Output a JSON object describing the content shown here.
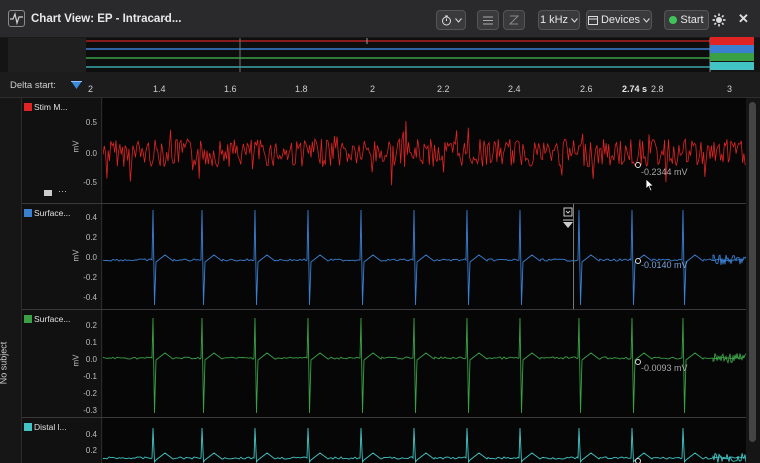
{
  "titlebar": {
    "title": "Chart View: EP - Intracard...",
    "more": "···",
    "rate": "1 kHz",
    "devices": "Devices",
    "start": "Start",
    "close": "✕"
  },
  "overview": {
    "colors": [
      "#e02424",
      "#3a7fd0",
      "#3aa046",
      "#43c4c4"
    ]
  },
  "delta": {
    "label": "Delta start:",
    "ticks": [
      "2",
      "1.4",
      "1.6",
      "1.8",
      "2",
      "2.2",
      "2.4",
      "2.6",
      "2.8",
      "3"
    ],
    "readout": "2.74 s"
  },
  "side": {
    "no_subject": "No subject"
  },
  "channels": [
    {
      "name": "Stim M...",
      "color": "#e02424",
      "unit": "mV",
      "yticks": [
        "0.5",
        "0.0",
        "-0.5"
      ],
      "readout": "-0.2344 mV"
    },
    {
      "name": "Surface...",
      "color": "#3a7fd0",
      "unit": "mV",
      "yticks": [
        "0.4",
        "0.2",
        "0.0",
        "-0.2",
        "-0.4"
      ],
      "readout": "-0.0140 mV"
    },
    {
      "name": "Surface...",
      "color": "#3aa046",
      "unit": "mV",
      "yticks": [
        "0.2",
        "0.1",
        "0.0",
        "-0.1",
        "-0.2",
        "-0.3"
      ],
      "readout": "-0.0093 mV"
    },
    {
      "name": "Distal l...",
      "color": "#43c4c4",
      "unit": "mV",
      "yticks": [
        "0.4",
        "0.2"
      ],
      "readout": ""
    }
  ]
}
